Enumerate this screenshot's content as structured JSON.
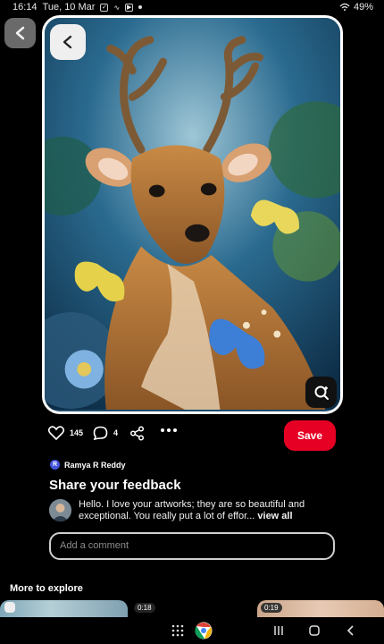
{
  "status_bar": {
    "time": "16:14",
    "date": "Tue, 10 Mar",
    "battery": "49%"
  },
  "pin": {
    "icons": {
      "outer_back": "chevron-left-icon",
      "inner_back": "chevron-left-icon",
      "visual_search": "lens-search-icon"
    },
    "artwork_colors": {
      "background": "#1d4d6e",
      "deer": "#b87a3a",
      "butterfly_blue": "#3d7fd6",
      "butterfly_yellow": "#e6d24a"
    }
  },
  "actions": {
    "like_count": "145",
    "comment_count": "4",
    "save_label": "Save",
    "accent": "#e60023"
  },
  "author": {
    "initial": "R",
    "name": "Ramya R Reddy"
  },
  "feedback": {
    "title": "Share your feedback",
    "comment_text": "Hello. I love your artworks; they are so beautiful and exceptional. You really put a lot of effor...",
    "view_all": "view all",
    "input_placeholder": "Add a comment"
  },
  "explore": {
    "title": "More to explore",
    "thumbs": [
      {
        "duration": "0:18"
      },
      {
        "duration": "0:19"
      }
    ]
  }
}
